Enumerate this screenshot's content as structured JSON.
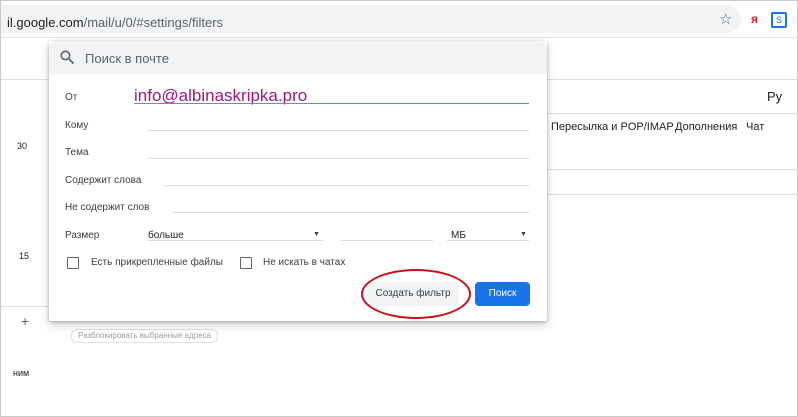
{
  "browser": {
    "url_host": "il.google.com",
    "url_path": "/mail/u/0/#settings/filters",
    "bookmark_icon": "star-icon",
    "extensions": [
      "yandex-icon",
      "sync-extension-icon"
    ],
    "ya_label": "я",
    "ext_label": "S"
  },
  "background": {
    "lang_label": "Ру",
    "tabs": [
      "Пересылка и POP/IMAP",
      "Дополнения",
      "Чат"
    ],
    "left_num_1": "30",
    "left_num_2": "15",
    "plus": "+",
    "left_word": "ним",
    "chip": "Разблокировать выбранные адреса"
  },
  "search": {
    "placeholder": "Поиск в почте",
    "icon": "search-icon"
  },
  "filter_form": {
    "from_label": "От",
    "from_value": "info@albinaskripka.pro",
    "to_label": "Кому",
    "subject_label": "Тема",
    "has_words_label": "Содержит слова",
    "no_words_label": "Не содержит слов",
    "size_label": "Размер",
    "size_operator": "больше",
    "size_unit": "МБ",
    "has_attachment_label": "Есть прикрепленные файлы",
    "exclude_chats_label": "Не искать в чатах",
    "create_filter_button": "Создать фильтр",
    "search_button": "Поиск"
  },
  "colors": {
    "primary": "#1a73e8",
    "annotation": "#c4121e",
    "from_text": "#a2177a"
  }
}
